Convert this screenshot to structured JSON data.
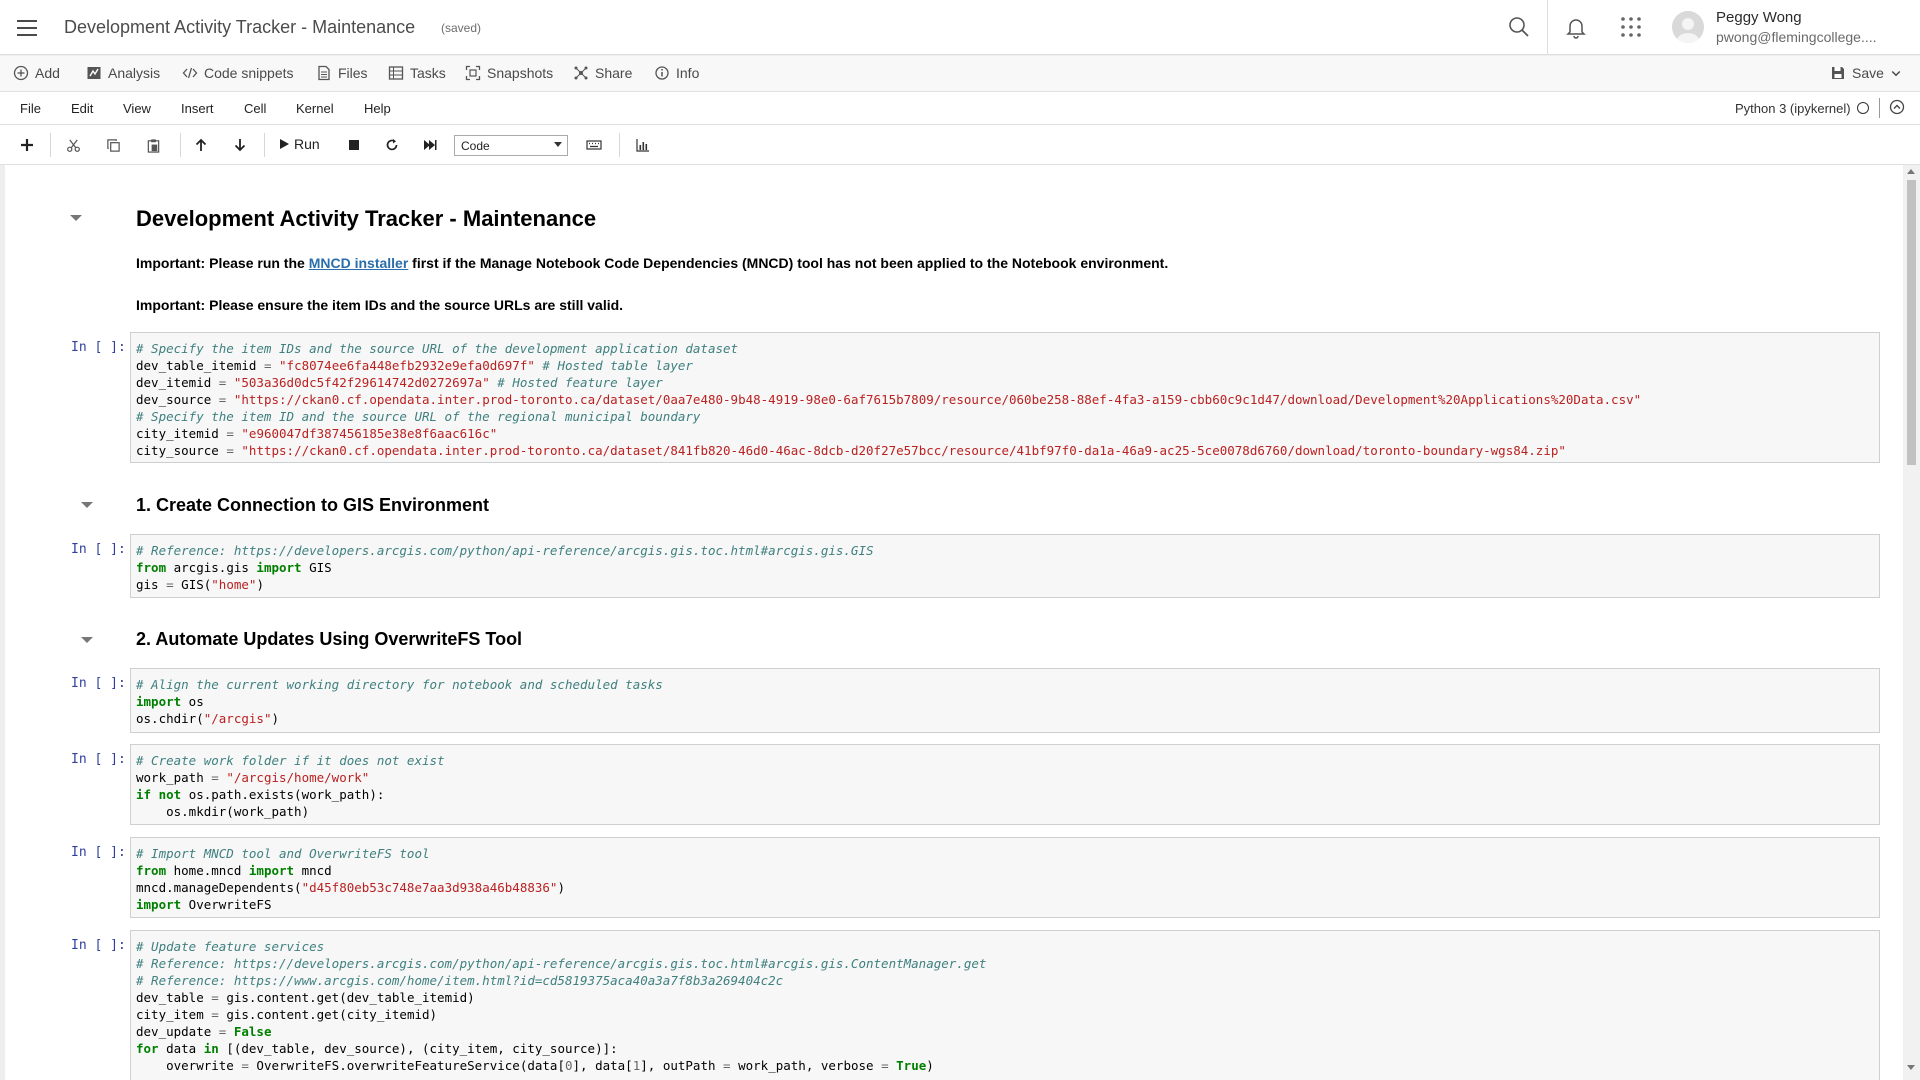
{
  "header": {
    "title": "Development Activity Tracker - Maintenance",
    "saved": "(saved)",
    "user_name": "Peggy Wong",
    "user_email": "pwong@flemingcollege...."
  },
  "toolbar1": {
    "items": [
      "Add",
      "Analysis",
      "Code snippets",
      "Files",
      "Tasks",
      "Snapshots",
      "Share",
      "Info"
    ],
    "save": "Save"
  },
  "menubar": {
    "items": [
      "File",
      "Edit",
      "View",
      "Insert",
      "Cell",
      "Kernel",
      "Help"
    ],
    "kernel": "Python 3 (ipykernel)"
  },
  "toolbar2": {
    "run": "Run",
    "cell_type": "Code"
  },
  "notebook": {
    "h1": "Development Activity Tracker - Maintenance",
    "md1_prefix": "Important: Please run the ",
    "md1_link": "MNCD installer",
    "md1_suffix": " first if the Manage Notebook Code Dependencies (MNCD) tool has not been applied to the Notebook environment.",
    "md2": "Important: Please ensure the item IDs and the source URLs are still valid.",
    "h2_1": "1. Create Connection to GIS Environment",
    "h2_2": "2. Automate Updates Using OverwriteFS Tool",
    "prompt": "In [ ]:",
    "cells": {
      "c1": {
        "comment1": "# Specify the item IDs and the source URL of the development application dataset",
        "l2": {
          "var": "dev_table_itemid",
          "str": "\"fc8074ee6fa448efb2932e9efa0d697f\"",
          "comment": "# Hosted table layer"
        },
        "l3": {
          "var": "dev_itemid",
          "str": "\"503a36d0dc5f42f29614742d0272697a\"",
          "comment": "# Hosted feature layer"
        },
        "l4": {
          "var": "dev_source",
          "str": "\"https://ckan0.cf.opendata.inter.prod-toronto.ca/dataset/0aa7e480-9b48-4919-98e0-6af7615b7809/resource/060be258-88ef-4fa3-a159-cbb60c9c1d47/download/Development%20Applications%20Data.csv\""
        },
        "comment2": "# Specify the item ID and the source URL of the regional municipal boundary",
        "l6": {
          "var": "city_itemid",
          "str": "\"e960047df387456185e38e8f6aac616c\""
        },
        "l7": {
          "var": "city_source",
          "str": "\"https://ckan0.cf.opendata.inter.prod-toronto.ca/dataset/841fb820-46d0-46ac-8dcb-d20f27e57bcc/resource/41bf97f0-da1a-46a9-ac25-5ce0078d6760/download/toronto-boundary-wgs84.zip\""
        }
      },
      "c2": {
        "comment": "# Reference: https://developers.arcgis.com/python/api-reference/arcgis.gis.toc.html#arcgis.gis.GIS",
        "from_kw": "from",
        "module": " arcgis.gis ",
        "import_kw": "import",
        "name": " GIS",
        "l3_prefix": "gis ",
        "l3_eq": "=",
        "l3_call": " GIS(",
        "l3_str": "\"home\"",
        "l3_end": ")"
      },
      "c3": {
        "comment": "# Align the current working directory for notebook and scheduled tasks",
        "import_kw": "import",
        "module": " os",
        "l3_call": "os.chdir(",
        "l3_str": "\"/arcgis\"",
        "l3_end": ")"
      },
      "c4": {
        "comment": "# Create work folder if it does not exist",
        "l2_var": "work_path ",
        "l2_eq": "=",
        "l2_str": "\"/arcgis/home/work\"",
        "if_kw": "if",
        "not_kw": "not",
        "l3_rest": " os.path.exists(work_path):",
        "l4": "    os.mkdir(work_path)"
      },
      "c5": {
        "comment": "# Import MNCD tool and OverwriteFS tool",
        "from_kw": "from",
        "module": " home.mncd ",
        "import_kw": "import",
        "name": " mncd",
        "l3_call": "mncd.manageDependents(",
        "l3_str": "\"d45f80eb53c748e7aa3d938a46b48836\"",
        "l3_end": ")",
        "l4_import": "import",
        "l4_name": " OverwriteFS"
      },
      "c6": {
        "comment1": "# Update feature services",
        "comment2": "# Reference: https://developers.arcgis.com/python/api-reference/arcgis.gis.toc.html#arcgis.gis.ContentManager.get",
        "comment3": "# Reference: https://www.arcgis.com/home/item.html?id=cd5819375aca40a3a7f8b3a269404c2c",
        "l4_var": "dev_table ",
        "l4_eq": "=",
        "l4_rest": " gis.content.get(dev_table_itemid)",
        "l5_var": "city_item ",
        "l5_eq": "=",
        "l5_rest": " gis.content.get(city_itemid)",
        "l6_var": "dev_update ",
        "l6_eq": "=",
        "l6_val": "False",
        "for_kw": "for",
        "l7_a": " data ",
        "in_kw": "in",
        "l7_b": " [(dev_table, dev_source), (city_item, city_source)]:",
        "l8_a": "    overwrite ",
        "l8_eq": "=",
        "l8_b": " OverwriteFS.overwriteFeatureService(data[",
        "l8_n0": "0",
        "l8_c": "], data[",
        "l8_n1": "1",
        "l8_d": "], outPath ",
        "l8_eq2": "=",
        "l8_e": " work_path, verbose ",
        "l8_eq3": "=",
        "l8_true": "True",
        "l8_end": ")"
      }
    }
  }
}
